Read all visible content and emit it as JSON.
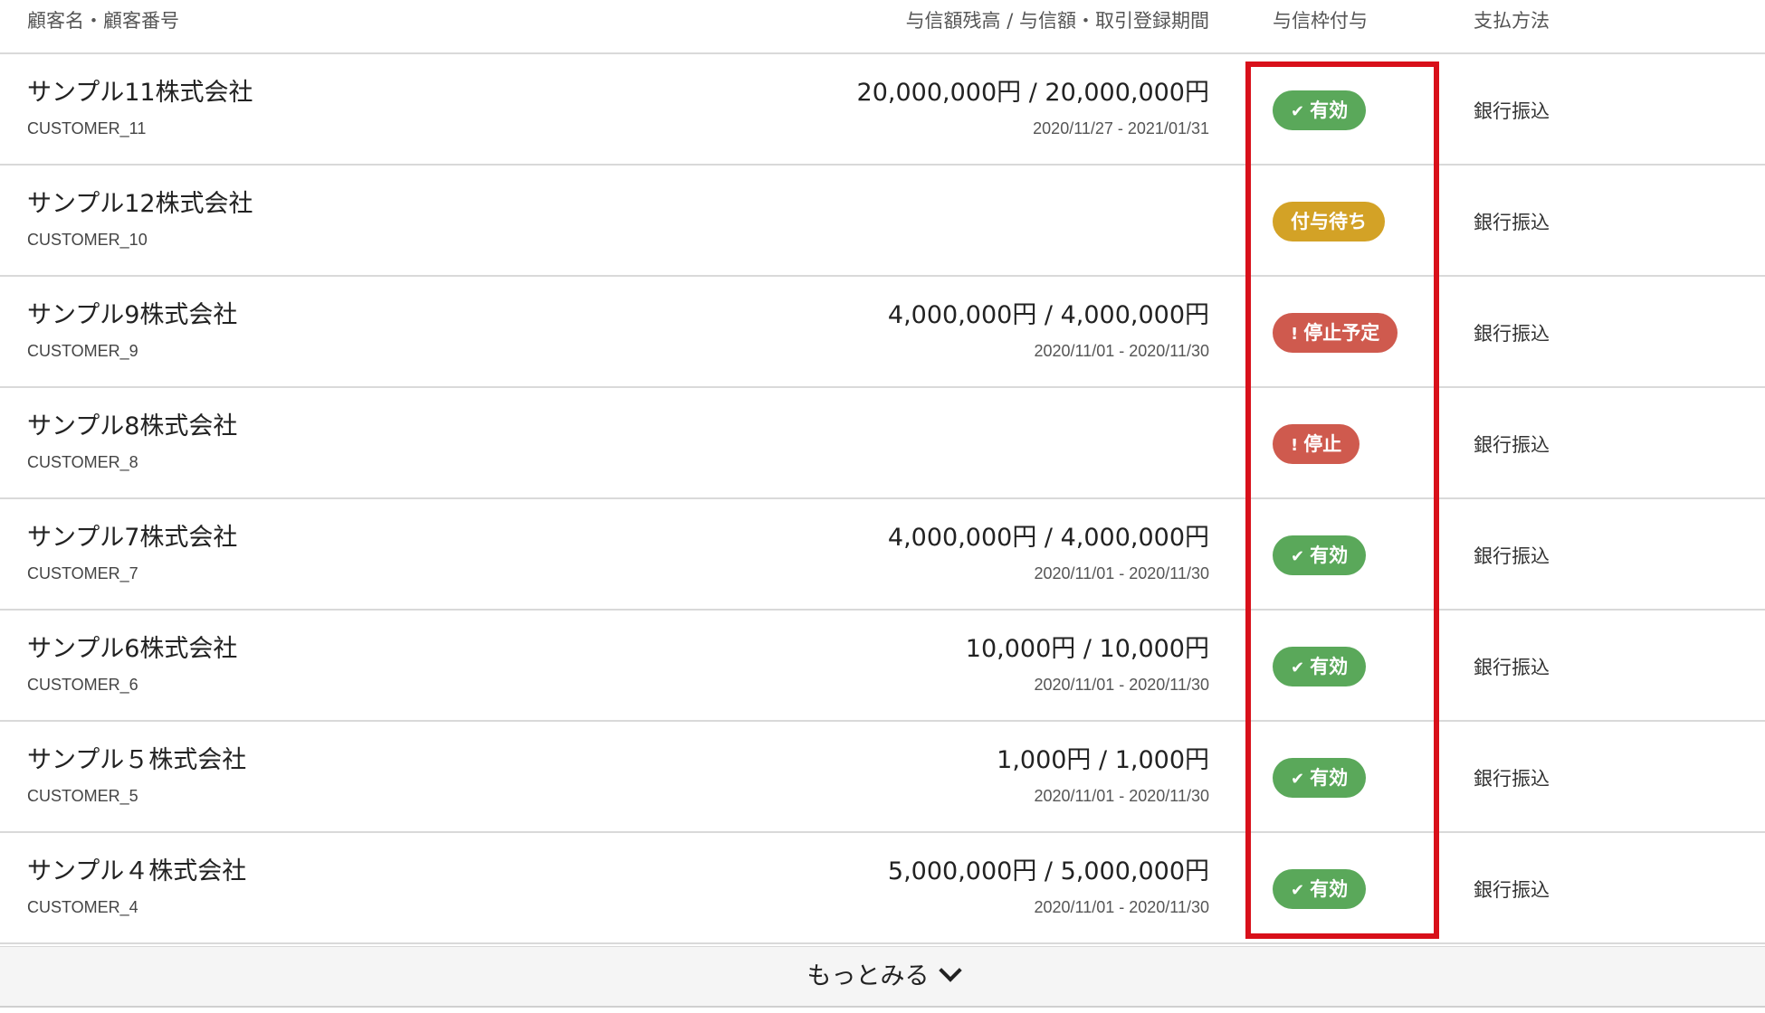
{
  "header": {
    "name_col": "顧客名・顧客番号",
    "credit_col": "与信額残高 / 与信額・取引登録期間",
    "status_col": "与信枠付与",
    "payment_col": "支払方法"
  },
  "rows": [
    {
      "name": "サンプル11株式会社",
      "code": "CUSTOMER_11",
      "amount": "20,000,000円 / 20,000,000円",
      "period": "2020/11/27 - 2021/01/31",
      "status": "有効",
      "status_icon": "check-icon",
      "payment": "銀行振込"
    },
    {
      "name": "サンプル12株式会社",
      "code": "CUSTOMER_10",
      "amount": "",
      "period": "",
      "status": "付与待ち",
      "status_icon": "",
      "payment": "銀行振込"
    },
    {
      "name": "サンプル9株式会社",
      "code": "CUSTOMER_9",
      "amount": "4,000,000円 / 4,000,000円",
      "period": "2020/11/01 - 2020/11/30",
      "status": "停止予定",
      "status_icon": "exclamation-icon",
      "payment": "銀行振込"
    },
    {
      "name": "サンプル8株式会社",
      "code": "CUSTOMER_8",
      "amount": "",
      "period": "",
      "status": "停止",
      "status_icon": "exclamation-icon",
      "payment": "銀行振込"
    },
    {
      "name": "サンプル7株式会社",
      "code": "CUSTOMER_7",
      "amount": "4,000,000円 / 4,000,000円",
      "period": "2020/11/01 - 2020/11/30",
      "status": "有効",
      "status_icon": "check-icon",
      "payment": "銀行振込"
    },
    {
      "name": "サンプル6株式会社",
      "code": "CUSTOMER_6",
      "amount": "10,000円 / 10,000円",
      "period": "2020/11/01 - 2020/11/30",
      "status": "有効",
      "status_icon": "check-icon",
      "payment": "銀行振込"
    },
    {
      "name": "サンプル５株式会社",
      "code": "CUSTOMER_5",
      "amount": "1,000円 / 1,000円",
      "period": "2020/11/01 - 2020/11/30",
      "status": "有効",
      "status_icon": "check-icon",
      "payment": "銀行振込"
    },
    {
      "name": "サンプル４株式会社",
      "code": "CUSTOMER_4",
      "amount": "5,000,000円 / 5,000,000円",
      "period": "2020/11/01 - 2020/11/30",
      "status": "有効",
      "status_icon": "check-icon",
      "payment": "銀行振込"
    }
  ],
  "status_colors": {
    "有効": "#5aa85a",
    "付与待ち": "#d3a226",
    "停止予定": "#cf5a4e",
    "停止": "#cf5a4e"
  },
  "highlight_color": "#d8101a",
  "more": {
    "label": "もっとみる",
    "icon": "chevron-down-icon"
  }
}
